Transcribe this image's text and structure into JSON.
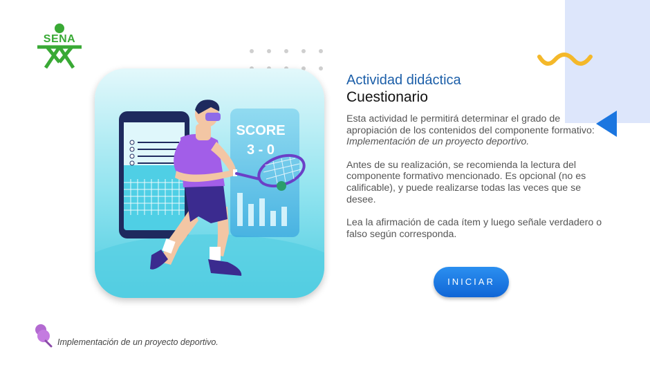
{
  "brand": {
    "logo_text": "SENA",
    "logo_color": "#39a935"
  },
  "activity": {
    "subtitle": "Actividad didáctica",
    "title": "Cuestionario",
    "p1_prefix": "Esta actividad le permitirá determinar el grado de apropiación de los contenidos del componente formativo: ",
    "p1_emph": "Implementación de un proyecto deportivo.",
    "p2": "Antes de su realización, se recomienda la lectura del componente formativo mencionado. Es opcional (no es calificable), y puede realizarse todas las veces que se desee.",
    "p3": "Lea la afirmación de cada ítem y luego señale verdadero o falso según corresponda."
  },
  "illustration": {
    "score_label": "SCORE",
    "score_value": "3 - 0"
  },
  "start_button": {
    "label": "INICIAR",
    "color": "#1a7ae6"
  },
  "footer": {
    "text": "Implementación de un proyecto deportivo."
  },
  "colors": {
    "accent_blue": "#1b5ea8",
    "panel_bg": "#dde6fb",
    "squiggle": "#f4b82a",
    "triangle": "#1b76e0"
  },
  "icons": [
    "sena-logo",
    "dots-pattern",
    "squiggle-decoration",
    "triangle-decoration",
    "pushpin-icon"
  ]
}
